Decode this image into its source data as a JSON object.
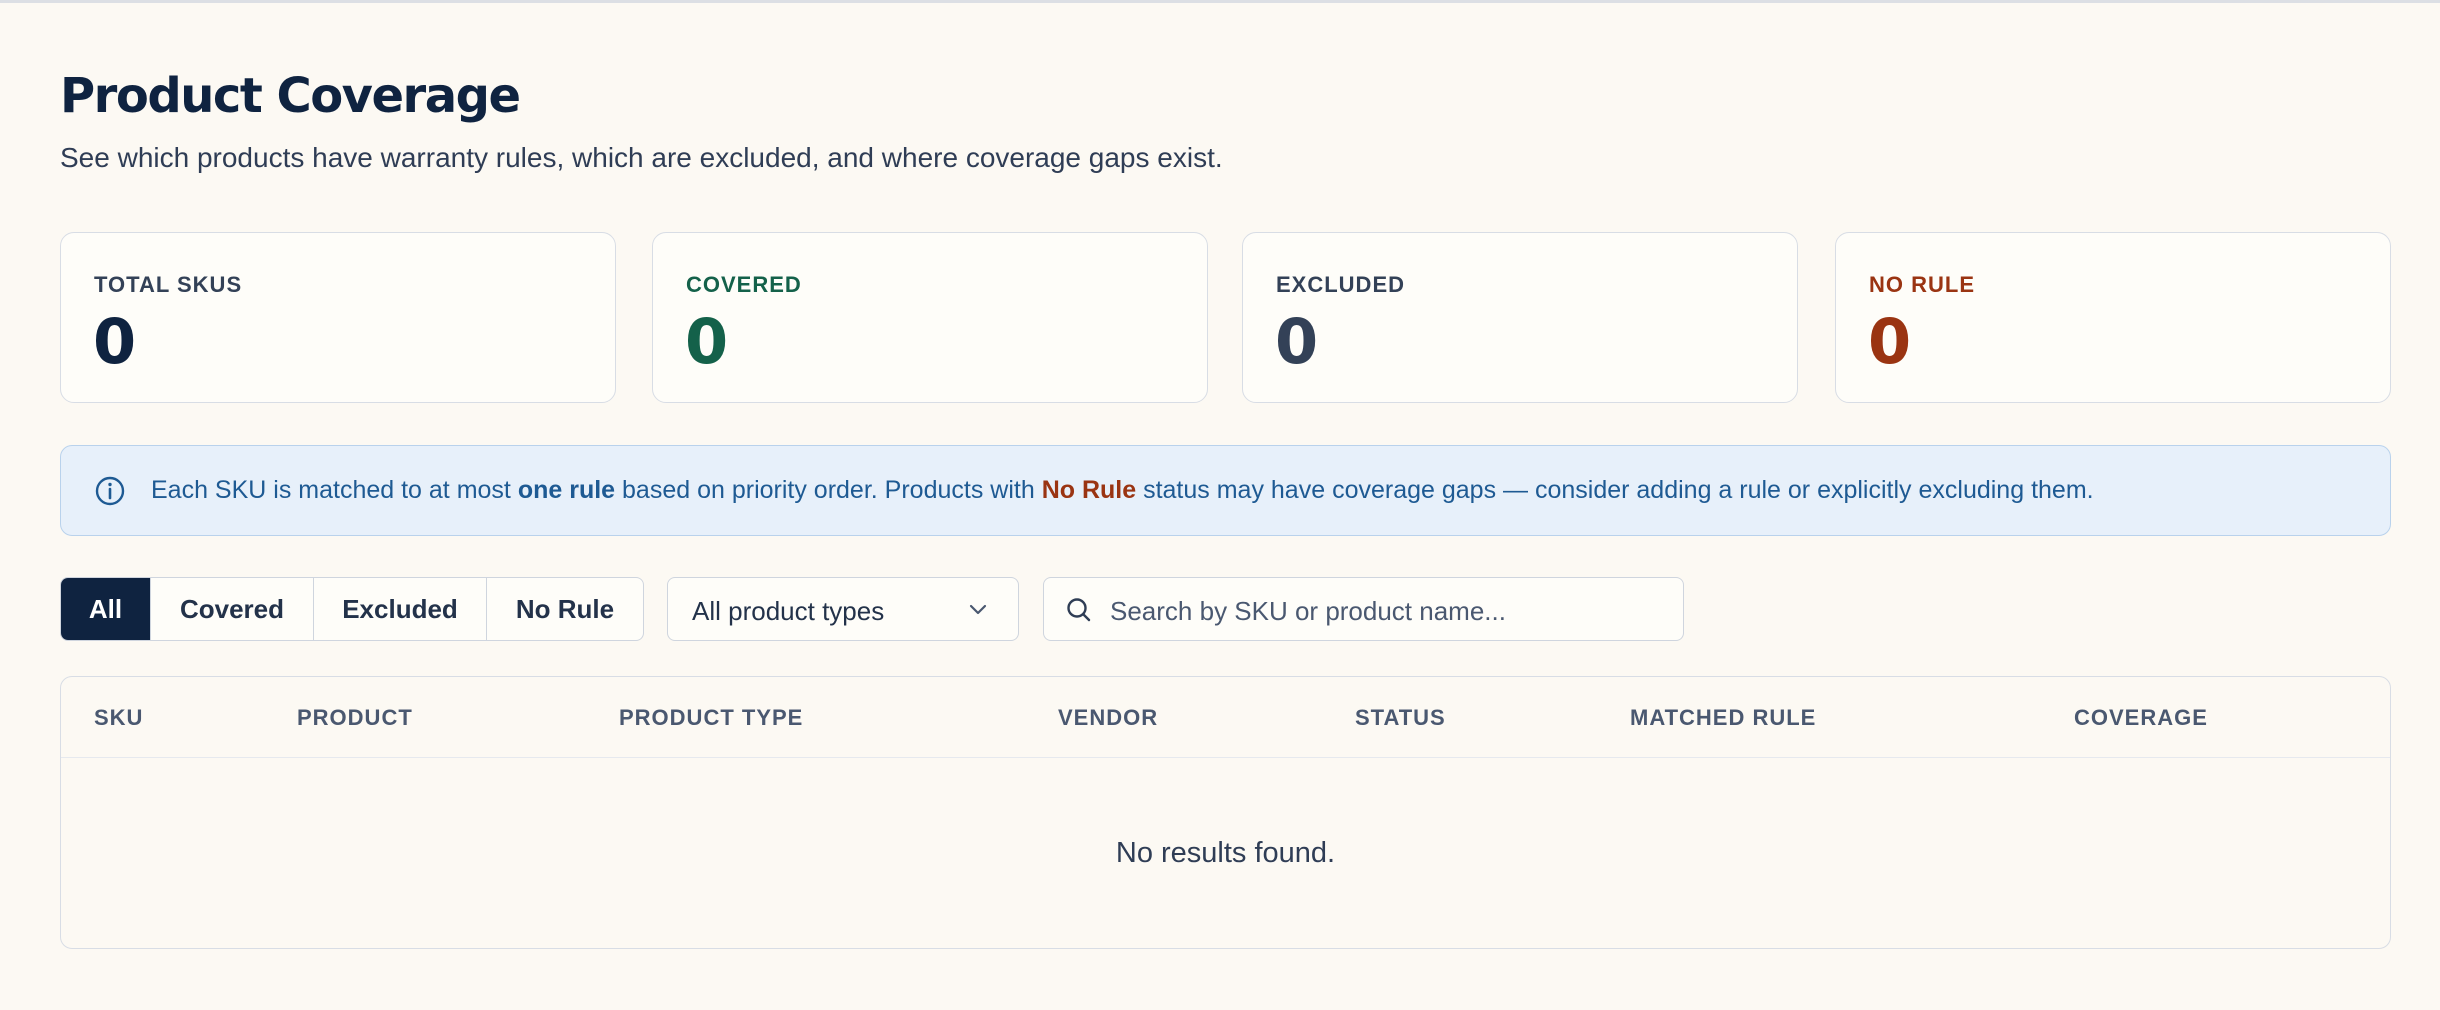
{
  "header": {
    "title": "Product Coverage",
    "subtitle": "See which products have warranty rules, which are excluded, and where coverage gaps exist."
  },
  "stats": [
    {
      "label": "TOTAL SKUS",
      "value": "0",
      "color": "#0f2340"
    },
    {
      "label": "COVERED",
      "value": "0",
      "color": "#14614a"
    },
    {
      "label": "EXCLUDED",
      "value": "0",
      "color": "#334157"
    },
    {
      "label": "NO RULE",
      "value": "0",
      "color": "#9a3412"
    }
  ],
  "info": {
    "icon": "info-circle-icon",
    "part1": "Each SKU is matched to at most ",
    "bold1": "one rule",
    "part2": " based on priority order. Products with ",
    "bold2": "No Rule",
    "part3": " status may have coverage gaps — consider adding a rule or explicitly excluding them."
  },
  "filters": {
    "segments": [
      "All",
      "Covered",
      "Excluded",
      "No Rule"
    ],
    "active": "All",
    "product_type": "All product types",
    "search_placeholder": "Search by SKU or product name..."
  },
  "table": {
    "columns": [
      "SKU",
      "PRODUCT",
      "PRODUCT TYPE",
      "VENDOR",
      "STATUS",
      "MATCHED RULE",
      "COVERAGE"
    ],
    "empty_message": "No results found."
  },
  "colors": {
    "accent": "#0f2340",
    "covered": "#14614a",
    "no_rule": "#9a3412",
    "info_bg": "#e7f0fa"
  }
}
